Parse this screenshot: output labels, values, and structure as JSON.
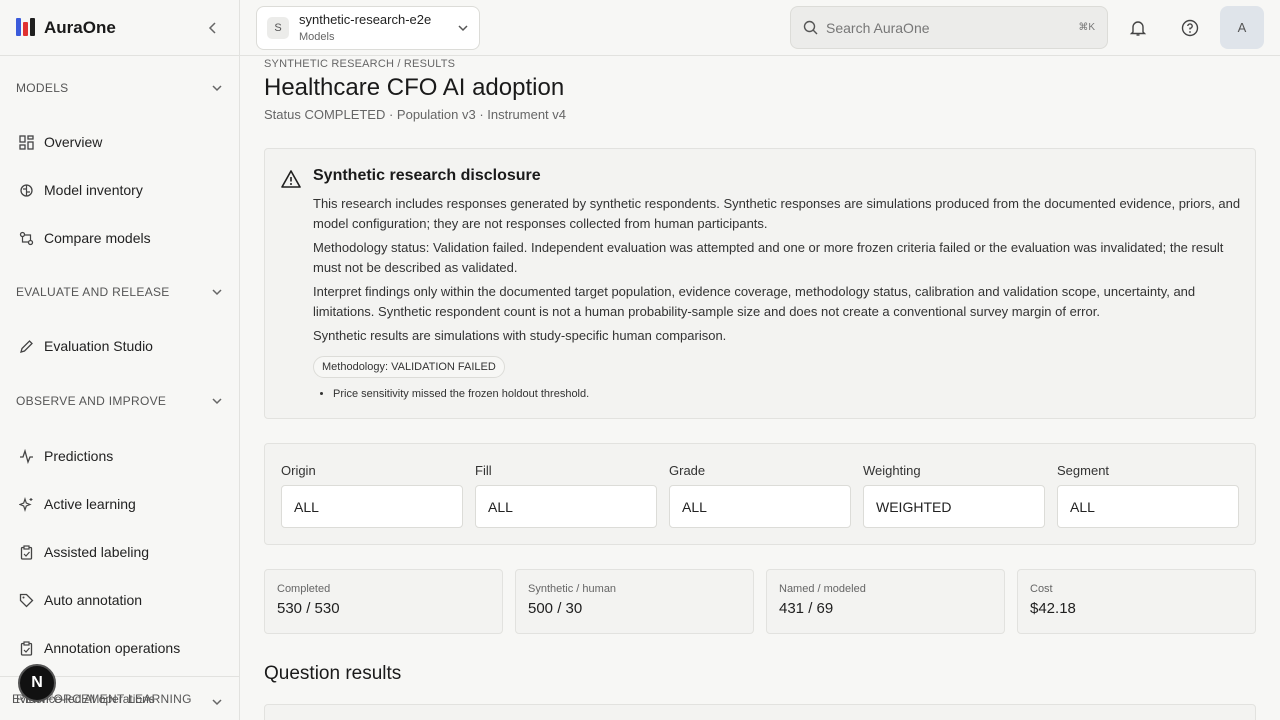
{
  "sidebar": {
    "brand": "AuraOne",
    "sections": [
      {
        "label": "MODELS",
        "items": [
          "Overview",
          "Model inventory",
          "Compare models"
        ]
      },
      {
        "label": "EVALUATE AND RELEASE",
        "items": [
          "Evaluation Studio"
        ]
      },
      {
        "label": "OBSERVE AND IMPROVE",
        "items": [
          "Predictions",
          "Active learning",
          "Assisted labeling",
          "Auto annotation",
          "Annotation operations"
        ]
      },
      {
        "label": "REINFORCEMENT LEARNING"
      }
    ],
    "footer": "Evidence-led AI operations",
    "badge": "N"
  },
  "topbar": {
    "project_initial": "S",
    "project_name": "synthetic-research-e2e",
    "project_sub": "Models",
    "search_placeholder": "Search AuraOne",
    "search_shortcut": "⌘K",
    "avatar": "A"
  },
  "page": {
    "breadcrumb": "SYNTHETIC RESEARCH / RESULTS",
    "title": "Healthcare CFO AI adoption",
    "meta": "Status COMPLETED · Population v3 · Instrument v4"
  },
  "disclosure": {
    "title": "Synthetic research disclosure",
    "paragraphs": [
      "This research includes responses generated by synthetic respondents. Synthetic responses are simulations produced from the documented evidence, priors, and model configuration; they are not responses collected from human participants.",
      "Methodology status: Validation failed. Independent evaluation was attempted and one or more frozen criteria failed or the evaluation was invalidated; the result must not be described as validated.",
      "Interpret findings only within the documented target population, evidence coverage, methodology status, calibration and validation scope, uncertainty, and limitations. Synthetic respondent count is not a human probability-sample size and does not create a conventional survey margin of error.",
      "Synthetic results are simulations with study-specific human comparison."
    ],
    "pill": "Methodology: VALIDATION FAILED",
    "bullets": [
      "Price sensitivity missed the frozen holdout threshold."
    ]
  },
  "filters": [
    {
      "label": "Origin",
      "value": "ALL"
    },
    {
      "label": "Fill",
      "value": "ALL"
    },
    {
      "label": "Grade",
      "value": "ALL"
    },
    {
      "label": "Weighting",
      "value": "WEIGHTED"
    },
    {
      "label": "Segment",
      "value": "ALL"
    }
  ],
  "stats": [
    {
      "label": "Completed",
      "value": "530 / 530"
    },
    {
      "label": "Synthetic / human",
      "value": "500 / 30"
    },
    {
      "label": "Named / modeled",
      "value": "431 / 69"
    },
    {
      "label": "Cost",
      "value": "$42.18"
    }
  ],
  "results": {
    "title": "Question results"
  },
  "colors": {
    "accent": "#1f1f1f",
    "logo_blue": "#3b5bdb",
    "logo_red": "#e03131"
  }
}
